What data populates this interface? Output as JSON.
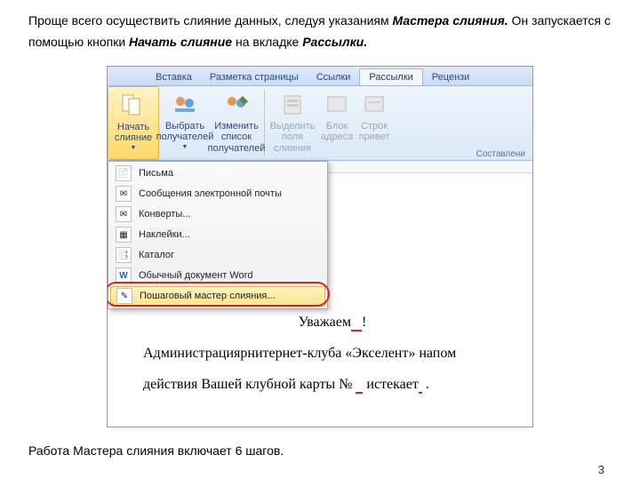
{
  "intro": {
    "p1a": "Проще всего осуществить слияние данных, следуя указаниям ",
    "p1b": "Мастера слияния.",
    "p1c": " Он запускается с помощью кнопки ",
    "p1d": "Начать слияние",
    "p1e": " на вкладке ",
    "p1f": "Рассылки.",
    "outro": "Работа Мастера слияния включает 6 шагов.",
    "pagenum": "3"
  },
  "tabs": [
    "Вставка",
    "Разметка страницы",
    "Ссылки",
    "Рассылки",
    "Рецензи"
  ],
  "ribbon": {
    "start": "Начать слияние",
    "select": "Выбрать получателей",
    "edit": "Изменить список получателей",
    "highlight": "Выделить поля слияния",
    "block": "Блок адреса",
    "line": "Строк привет",
    "group2": "Составлени"
  },
  "dropdown": {
    "items": [
      "Письма",
      "Сообщения электронной почты",
      "Конверты...",
      "Наклейки...",
      "Каталог",
      "Обычный документ Word",
      "Пошаговый мастер слияния..."
    ]
  },
  "doc": {
    "greet": "Уважаем",
    "excl": "!",
    "l2a": "Администрациярнитернет-клуба «Экселент» напом",
    "l3a": "действия Вашей клубной карты № ",
    "l3b": "истекает",
    "l3c": " ."
  }
}
